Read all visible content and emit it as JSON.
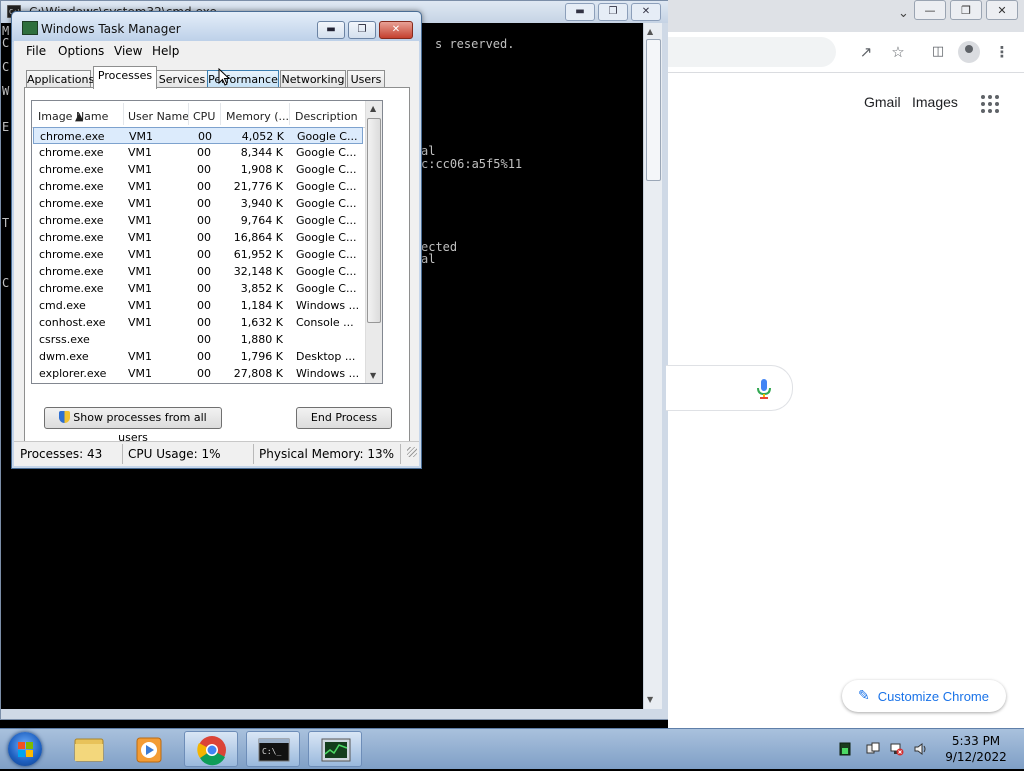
{
  "cmd": {
    "title": "C:\\Windows\\system32\\cmd.exe",
    "lines": {
      "l1": "s reserved.",
      "l2": "al",
      "l3": "c:cc06:a5f5%11",
      "l4": "ected",
      "l5": "al"
    },
    "left_chars": [
      "M",
      "C",
      "C",
      "W",
      "E",
      "T",
      "C"
    ]
  },
  "chrome": {
    "links": {
      "gmail": "Gmail",
      "images": "Images"
    },
    "customize_label": "Customize Chrome"
  },
  "taskmgr": {
    "title": "Windows Task Manager",
    "menu": [
      "File",
      "Options",
      "View",
      "Help"
    ],
    "tabs": [
      "Applications",
      "Processes",
      "Services",
      "Performance",
      "Networking",
      "Users"
    ],
    "active_tab": "Processes",
    "columns": [
      "Image Name",
      "User Name",
      "CPU",
      "Memory (...",
      "Description"
    ],
    "rows": [
      {
        "name": "chrome.exe",
        "user": "VM1",
        "cpu": "00",
        "mem": "4,052 K",
        "desc": "Google C..."
      },
      {
        "name": "chrome.exe",
        "user": "VM1",
        "cpu": "00",
        "mem": "8,344 K",
        "desc": "Google C..."
      },
      {
        "name": "chrome.exe",
        "user": "VM1",
        "cpu": "00",
        "mem": "1,908 K",
        "desc": "Google C..."
      },
      {
        "name": "chrome.exe",
        "user": "VM1",
        "cpu": "00",
        "mem": "21,776 K",
        "desc": "Google C..."
      },
      {
        "name": "chrome.exe",
        "user": "VM1",
        "cpu": "00",
        "mem": "3,940 K",
        "desc": "Google C..."
      },
      {
        "name": "chrome.exe",
        "user": "VM1",
        "cpu": "00",
        "mem": "9,764 K",
        "desc": "Google C..."
      },
      {
        "name": "chrome.exe",
        "user": "VM1",
        "cpu": "00",
        "mem": "16,864 K",
        "desc": "Google C..."
      },
      {
        "name": "chrome.exe",
        "user": "VM1",
        "cpu": "00",
        "mem": "61,952 K",
        "desc": "Google C..."
      },
      {
        "name": "chrome.exe",
        "user": "VM1",
        "cpu": "00",
        "mem": "32,148 K",
        "desc": "Google C..."
      },
      {
        "name": "chrome.exe",
        "user": "VM1",
        "cpu": "00",
        "mem": "3,852 K",
        "desc": "Google C..."
      },
      {
        "name": "cmd.exe",
        "user": "VM1",
        "cpu": "00",
        "mem": "1,184 K",
        "desc": "Windows ..."
      },
      {
        "name": "conhost.exe",
        "user": "VM1",
        "cpu": "00",
        "mem": "1,632 K",
        "desc": "Console ..."
      },
      {
        "name": "csrss.exe",
        "user": "",
        "cpu": "00",
        "mem": "1,880 K",
        "desc": ""
      },
      {
        "name": "dwm.exe",
        "user": "VM1",
        "cpu": "00",
        "mem": "1,796 K",
        "desc": "Desktop ..."
      },
      {
        "name": "explorer.exe",
        "user": "VM1",
        "cpu": "00",
        "mem": "27,808 K",
        "desc": "Windows ..."
      }
    ],
    "show_all_label": "Show processes from all users",
    "end_process_label": "End Process",
    "status": {
      "processes": "Processes: 43",
      "cpu": "CPU Usage: 1%",
      "memory": "Physical Memory: 13%"
    }
  },
  "taskbar": {
    "time": "5:33 PM",
    "date": "9/12/2022"
  },
  "colors": {
    "chrome_accent": "#1a73e8",
    "selection": "#dcebfc",
    "taskbar": "#8eabcf"
  }
}
